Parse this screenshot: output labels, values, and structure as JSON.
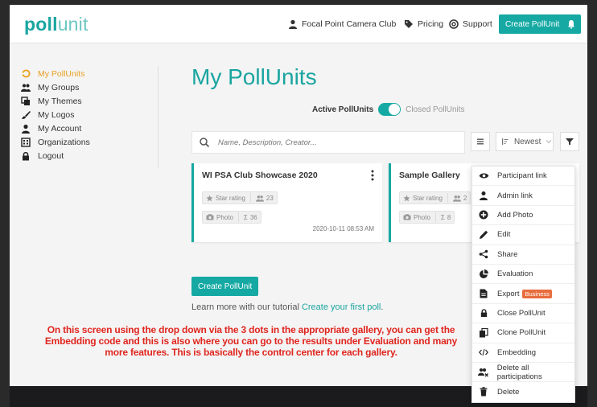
{
  "logo": {
    "bold": "poll",
    "thin": "unit"
  },
  "topnav": {
    "account": "Focal Point Camera Club",
    "pricing": "Pricing",
    "support": "Support",
    "create_button": "Create PollUnit"
  },
  "sidebar": {
    "items": [
      {
        "label": "My PollUnits",
        "icon": "poll-icon",
        "active": true
      },
      {
        "label": "My Groups",
        "icon": "group-icon"
      },
      {
        "label": "My Themes",
        "icon": "theme-icon"
      },
      {
        "label": "My Logos",
        "icon": "brush-icon"
      },
      {
        "label": "My Account",
        "icon": "user-icon"
      },
      {
        "label": "Organizations",
        "icon": "building-icon"
      },
      {
        "label": "Logout",
        "icon": "lock-icon"
      }
    ]
  },
  "main": {
    "title": "My PollUnits",
    "toggle_active": "Active PollUnits",
    "toggle_closed": "Closed PollUnits",
    "search_placeholder": "Name, Description, Creator...",
    "sort_label": "Newest"
  },
  "cards": [
    {
      "title": "WI PSA Club Showcase 2020",
      "rating_chip": "Star rating",
      "participants": "23",
      "type_chip": "Photo",
      "count": "36",
      "date": "2020-10-11 08:53 AM"
    },
    {
      "title": "Sample Gallery",
      "rating_chip": "Star rating",
      "participants": "2",
      "type_chip": "Photo",
      "count": "8"
    }
  ],
  "create_button": "Create PollUnit",
  "learn_more": {
    "prefix": "Learn more with our tutorial ",
    "link": "Create your first poll",
    "suffix": "."
  },
  "annotation": "On this screen using the drop down via the 3 dots in the appropriate gallery, you can get the Embedding code and this is also where you can go to the results under Evaluation and many more features. This is basically the control center for each gallery.",
  "dropdown": {
    "items": [
      {
        "label": "Participant link",
        "icon": "eye-icon"
      },
      {
        "label": "Admin link",
        "icon": "admin-icon"
      },
      {
        "label": "Add Photo",
        "icon": "plus-circle-icon"
      },
      {
        "label": "Edit",
        "icon": "pencil-icon"
      },
      {
        "label": "Share",
        "icon": "share-icon"
      },
      {
        "label": "Evaluation",
        "icon": "pie-chart-icon"
      },
      {
        "label": "Export",
        "icon": "file-icon",
        "badge": "Business"
      },
      {
        "label": "Close PollUnit",
        "icon": "lock-icon"
      },
      {
        "label": "Clone PollUnit",
        "icon": "copy-icon"
      },
      {
        "label": "Embedding",
        "icon": "code-icon"
      },
      {
        "label": "Delete all participations",
        "icon": "users-remove-icon"
      },
      {
        "label": "Delete",
        "icon": "trash-icon"
      }
    ]
  },
  "colors": {
    "accent": "#16a9a3",
    "active_nav": "#e8a020",
    "annotation": "#e0261f",
    "badge": "#e86d3d"
  }
}
